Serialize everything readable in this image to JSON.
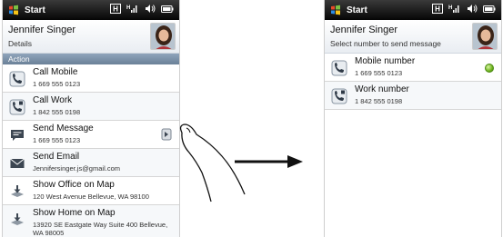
{
  "left": {
    "topbar": {
      "title": "Start"
    },
    "header": {
      "name": "Jennifer Singer",
      "subtitle": "Details"
    },
    "section": "Action",
    "items": [
      {
        "label": "Call Mobile",
        "detail": "1 669 555 0123",
        "icon": "phone-icon"
      },
      {
        "label": "Call Work",
        "detail": "1 842 555 0198",
        "icon": "phone-work-icon"
      },
      {
        "label": "Send Message",
        "detail": "1 669 555 0123",
        "icon": "message-icon"
      },
      {
        "label": "Send Email",
        "detail": "Jennifersinger.js@gmail.com",
        "icon": "email-icon"
      },
      {
        "label": "Show Office on Map",
        "detail": "120 West Avenue Bellevue, WA 98100",
        "icon": "map-icon"
      },
      {
        "label": "Show Home on Map",
        "detail": "13920 SE Eastgate Way Suite 400 Bellevue, WA 98005",
        "icon": "map-icon"
      }
    ]
  },
  "right": {
    "topbar": {
      "title": "Start"
    },
    "header": {
      "name": "Jennifer Singer",
      "subtitle": "Select number to send message"
    },
    "items": [
      {
        "label": "Mobile number",
        "detail": "1 669 555 0123",
        "icon": "mobile-phone-icon",
        "selected": true
      },
      {
        "label": "Work number",
        "detail": "1 842 555 0198",
        "icon": "work-phone-icon",
        "selected": false
      }
    ]
  },
  "colors": {
    "topbar": "#1a1a1a",
    "section": "#7a8fa6",
    "selected_dot": "#6fb31f"
  }
}
